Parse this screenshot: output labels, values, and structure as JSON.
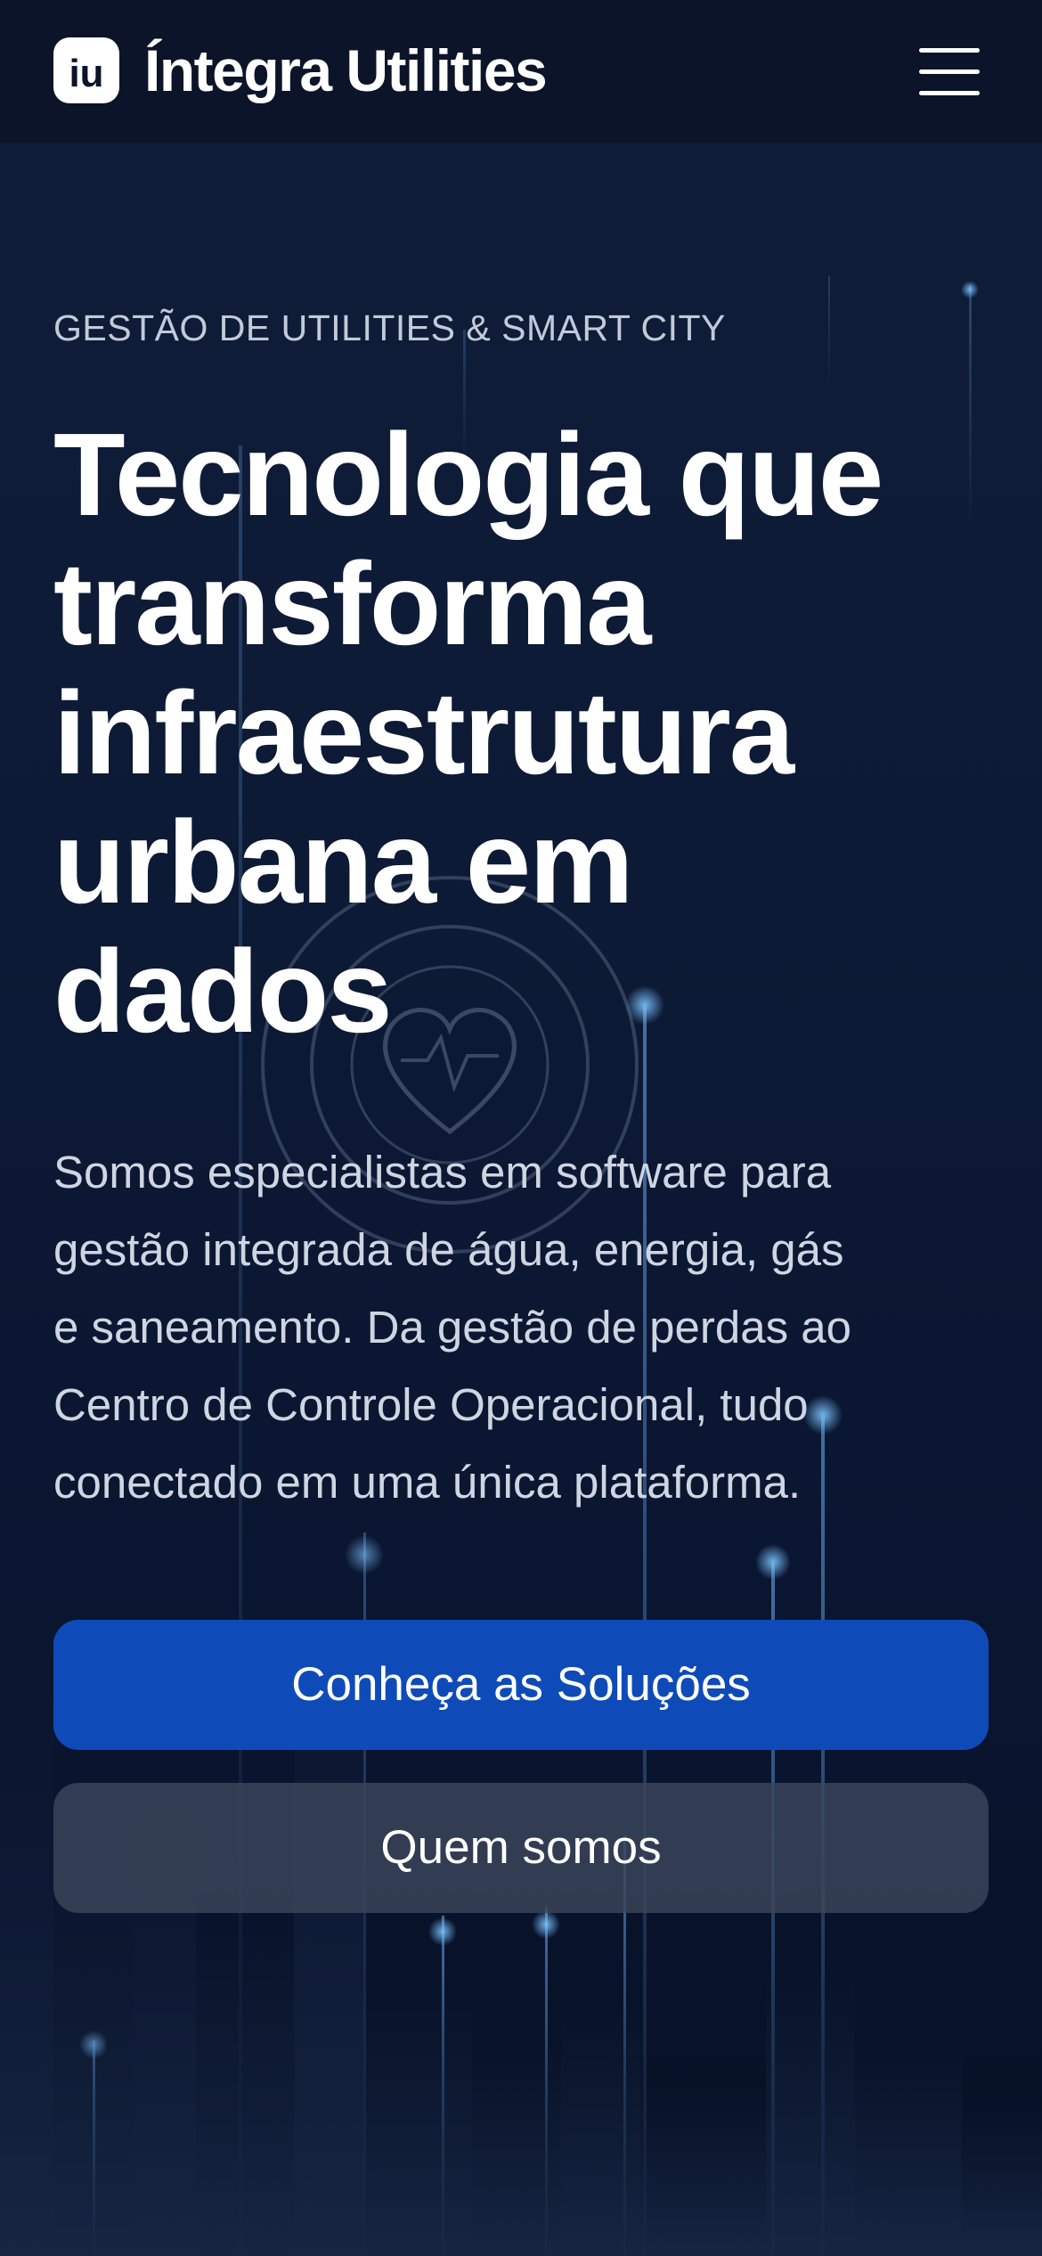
{
  "header": {
    "logo_glyph": "iu",
    "brand_name": "Íntegra Utilities",
    "menu_icon": "hamburger-menu-icon"
  },
  "hero": {
    "eyebrow": "GESTÃO DE UTILITIES & SMART CITY",
    "headline_lines": [
      "Tecnologia que",
      "transforma",
      "infraestrutura",
      "urbana em",
      "dados"
    ],
    "lead_lines": [
      "Somos especialistas em software para",
      "gestão integrada de água, energia, gás",
      "e saneamento. Da gestão de perdas ao",
      "Centro de Controle Operacional, tudo",
      "conectado em uma única plataforma."
    ]
  },
  "actions": {
    "primary_label": "Conheça as Soluções",
    "secondary_label": "Quem somos"
  },
  "colors": {
    "header_bg": "#0b1428",
    "page_bg": "#0d1a35",
    "primary_button": "#0f4bb8",
    "secondary_button": "#3c465a",
    "accent_glow": "#5fb0ff"
  }
}
